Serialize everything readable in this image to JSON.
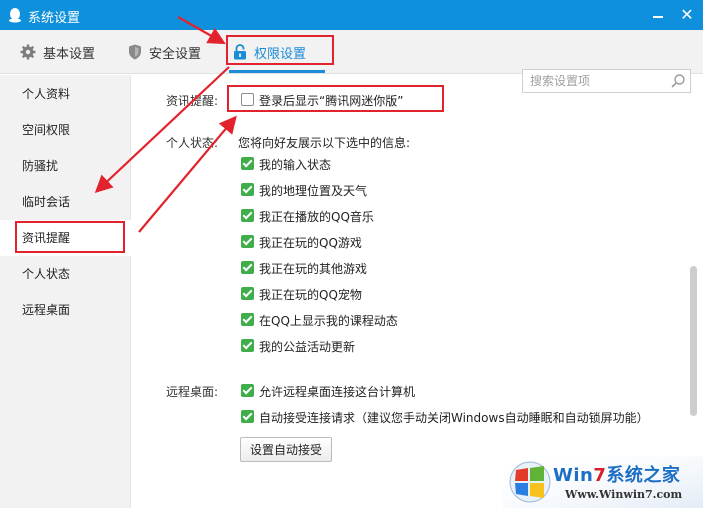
{
  "window": {
    "title": "系统设置",
    "minimize_icon": "minimize-icon",
    "close_label": "✕"
  },
  "tabs": [
    {
      "label": "基本设置",
      "icon": "gear-icon"
    },
    {
      "label": "安全设置",
      "icon": "shield-icon"
    },
    {
      "label": "权限设置",
      "icon": "lock-icon",
      "active": true
    }
  ],
  "search": {
    "placeholder": "搜索设置项"
  },
  "sidebar": {
    "items": [
      {
        "label": "个人资料"
      },
      {
        "label": "空间权限"
      },
      {
        "label": "防骚扰"
      },
      {
        "label": "临时会话"
      },
      {
        "label": "资讯提醒",
        "active": true
      },
      {
        "label": "个人状态"
      },
      {
        "label": "远程桌面"
      }
    ]
  },
  "news_alert": {
    "label": "资讯提醒:",
    "option": {
      "text": "登录后显示“腾讯网迷你版”",
      "checked": false
    }
  },
  "personal_status": {
    "label": "个人状态:",
    "intro": "您将向好友展示以下选中的信息:",
    "options": [
      {
        "text": "我的输入状态",
        "checked": true
      },
      {
        "text": "我的地理位置及天气",
        "checked": true
      },
      {
        "text": "我正在播放的QQ音乐",
        "checked": true
      },
      {
        "text": "我正在玩的QQ游戏",
        "checked": true
      },
      {
        "text": "我正在玩的其他游戏",
        "checked": true
      },
      {
        "text": "我正在玩的QQ宠物",
        "checked": true
      },
      {
        "text": "在QQ上显示我的课程动态",
        "checked": true
      },
      {
        "text": "我的公益活动更新",
        "checked": true
      }
    ]
  },
  "remote_desktop": {
    "label": "远程桌面:",
    "options": [
      {
        "text": "允许远程桌面连接这台计算机",
        "checked": true
      },
      {
        "text": "自动接受连接请求（建议您手动关闭Windows自动睡眠和自动锁屏功能）",
        "checked": true
      }
    ],
    "button_label": "设置自动接受"
  },
  "colors": {
    "accent": "#1a8cd8",
    "titlebar": "#0f90dc",
    "checkbox": "#3fae4a",
    "annotation": "#e2232d"
  },
  "watermark": {
    "win": "Win",
    "seven": "7",
    "brand": "系统之家",
    "url": "Www.Winwin7.com"
  }
}
